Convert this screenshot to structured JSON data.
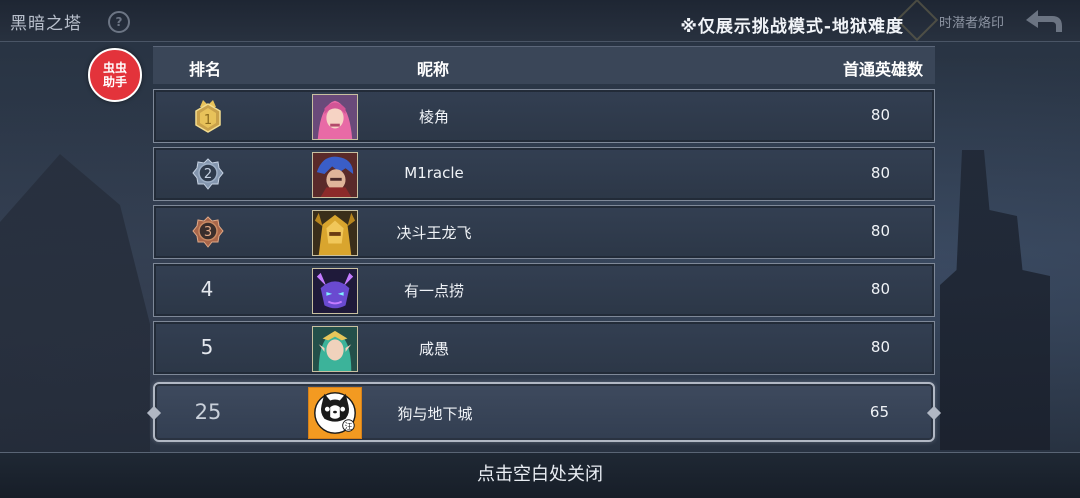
{
  "top_bar": {
    "title": "黑暗之塔",
    "notice": "※仅展示挑战模式-地狱难度",
    "right_label": "时潜者烙印"
  },
  "helper_badge": {
    "line1": "虫虫",
    "line2": "助手",
    "color": "#e3333b"
  },
  "table": {
    "headers": {
      "rank": "排名",
      "nickname": "昵称",
      "first_clear_heroes": "首通英雄数"
    },
    "rows": [
      {
        "rank": "1",
        "medal": "gold",
        "nickname": "棱角",
        "count": "80",
        "avatar_icon": "pink-haired-heroine"
      },
      {
        "rank": "2",
        "medal": "silver",
        "nickname": "M1racle",
        "count": "80",
        "avatar_icon": "blue-haired-warrior"
      },
      {
        "rank": "3",
        "medal": "bronze",
        "nickname": "决斗王龙飞",
        "count": "80",
        "avatar_icon": "golden-armored-knight"
      },
      {
        "rank": "4",
        "medal": "none",
        "nickname": "有一点捞",
        "count": "80",
        "avatar_icon": "purple-demon-mask"
      },
      {
        "rank": "5",
        "medal": "none",
        "nickname": "咸愚",
        "count": "80",
        "avatar_icon": "elf-priestess"
      }
    ],
    "own_row": {
      "rank": "25",
      "nickname": "狗与地下城",
      "count": "65",
      "avatar_icon": "cat-avatar",
      "avatar_badge": "汪"
    }
  },
  "footer": {
    "close_hint": "点击空白处关闭"
  },
  "colors": {
    "gold": "#e8c25a",
    "silver": "#9fb0c6",
    "bronze": "#c98a63",
    "avatar_orange": "#f39a21"
  }
}
